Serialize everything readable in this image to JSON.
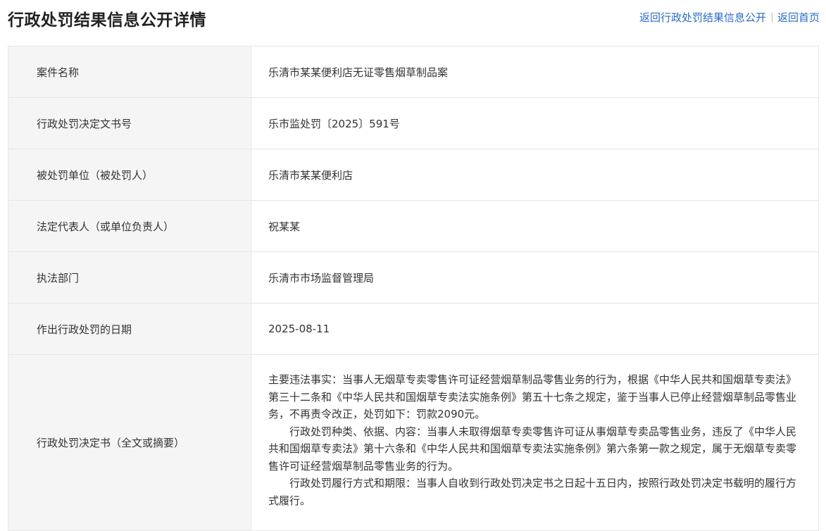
{
  "header": {
    "title": "行政处罚结果信息公开详情",
    "links": {
      "back_list": "返回行政处罚结果信息公开",
      "back_home": "返回首页"
    }
  },
  "table": {
    "rows": [
      {
        "label": "案件名称",
        "value": "乐清市某某便利店无证零售烟草制品案"
      },
      {
        "label": "行政处罚决定文书号",
        "value": "乐市监处罚〔2025〕591号"
      },
      {
        "label": "被处罚单位（被处罚人）",
        "value": "乐清市某某便利店"
      },
      {
        "label": "法定代表人（或单位负责人）",
        "value": "祝某某"
      },
      {
        "label": "执法部门",
        "value": "乐清市市场监督管理局"
      },
      {
        "label": "作出行政处罚的日期",
        "value": "2025-08-11"
      }
    ],
    "decision": {
      "label": "行政处罚决定书（全文或摘要）",
      "paragraphs": [
        "主要违法事实：当事人无烟草专卖零售许可证经营烟草制品零售业务的行为，根据《中华人民共和国烟草专卖法》第三十二条和《中华人民共和国烟草专卖法实施条例》第五十七条之规定，鉴于当事人已停止经营烟草制品零售业务，不再责令改正，处罚如下：罚款2090元。",
        "行政处罚种类、依据、内容：当事人未取得烟草专卖零售许可证从事烟草专卖品零售业务，违反了《中华人民共和国烟草专卖法》第十六条和《中华人民共和国烟草专卖法实施条例》第六条第一款之规定，属于无烟草专卖零售许可证经营烟草制品零售业务的行为。",
        "行政处罚履行方式和期限：当事人自收到行政处罚决定书之日起十五日内，按照行政处罚决定书载明的履行方式履行。"
      ]
    }
  }
}
